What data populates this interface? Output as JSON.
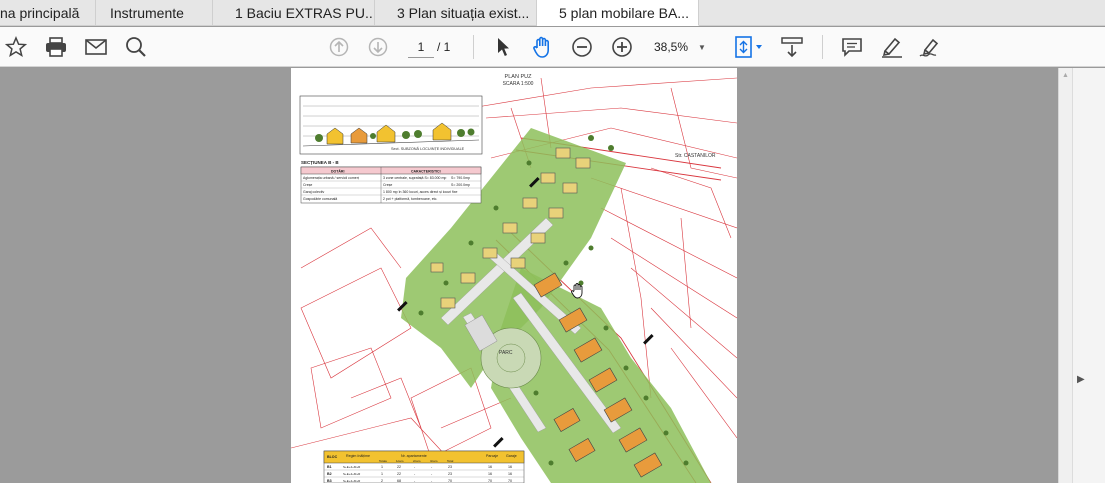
{
  "tabs": [
    {
      "label": "na principală",
      "active": false
    },
    {
      "label": "Instrumente",
      "active": false
    },
    {
      "label": "1 Baciu EXTRAS PU...",
      "active": false,
      "closable": true
    },
    {
      "label": "3 Plan situația exist...",
      "active": false,
      "closable": true
    },
    {
      "label": "5 plan mobilare BA...",
      "active": true,
      "closable": true
    }
  ],
  "tab_close_glyph": "×",
  "toolbar": {
    "icons": [
      "star-icon",
      "print-icon",
      "mail-icon",
      "search-zoom-icon",
      "page-up-icon",
      "page-down-icon",
      "select-cursor-icon",
      "hand-tool-icon",
      "zoom-out-icon",
      "zoom-in-icon",
      "fit-page-icon",
      "scroll-mode-icon",
      "comment-icon",
      "highlight-pen-icon",
      "sign-icon"
    ],
    "page_current": "1",
    "page_total": "/ 1",
    "zoom_value": "38,5%"
  },
  "document": {
    "title": "PLAN PUZ",
    "scale": "SCARA 1:500",
    "section_caption": "Sect. SUBZONĂ LOCUINȚE INDIVIDUALE",
    "section_title": "SECȚIUNEA B - B",
    "street_label": "Str. CASTANILOR",
    "park_label": "PARC",
    "dotari_table": {
      "headers": [
        "DOTĂRI",
        "CARACTERISTICI"
      ],
      "rows": [
        [
          "Aglomerația urbană / servicii comerț",
          "3 zone centrale, suprafață S= 83.000 mp",
          "S= 790.0mp"
        ],
        [
          "Creșe",
          "Creșe",
          "S= 200.0mp"
        ],
        [
          "Garaj colectiv",
          "1 800 mp în 360 locuri, acces direct și locuri fixe",
          ""
        ],
        [
          "Gospodărie comunală",
          "2 pct + platformă, tomberoane, etc.",
          ""
        ]
      ]
    },
    "bloc_table": {
      "headers": [
        "BLOC",
        "Regim înălțime",
        "Nr. apartamente",
        "Parcaje",
        "Garaje"
      ],
      "subheaders": [
        "Totale",
        "1cam.",
        "2cam.",
        "3cam.",
        "Total"
      ],
      "rows": [
        [
          "B1",
          "S+E+4+M+R",
          "1",
          "22",
          "-",
          "-",
          "23",
          "16",
          "16"
        ],
        [
          "B2",
          "S+E+4+M+R",
          "1",
          "22",
          "-",
          "-",
          "23",
          "16",
          "16"
        ],
        [
          "B3",
          "S+E+4+M+R",
          "2",
          "68",
          "-",
          "-",
          "70",
          "70",
          "70"
        ]
      ]
    }
  },
  "colors": {
    "tabbar_bg": "#e6e6e6",
    "toolbar_bg": "#fafafa",
    "workarea_bg": "#9b9b9b",
    "accent_blue": "#1473e6",
    "plan_red": "#d9363e",
    "plan_green": "#8dbf5a",
    "bloc_orange": "#e89b3c",
    "table_header_yellow": "#f2c230"
  }
}
